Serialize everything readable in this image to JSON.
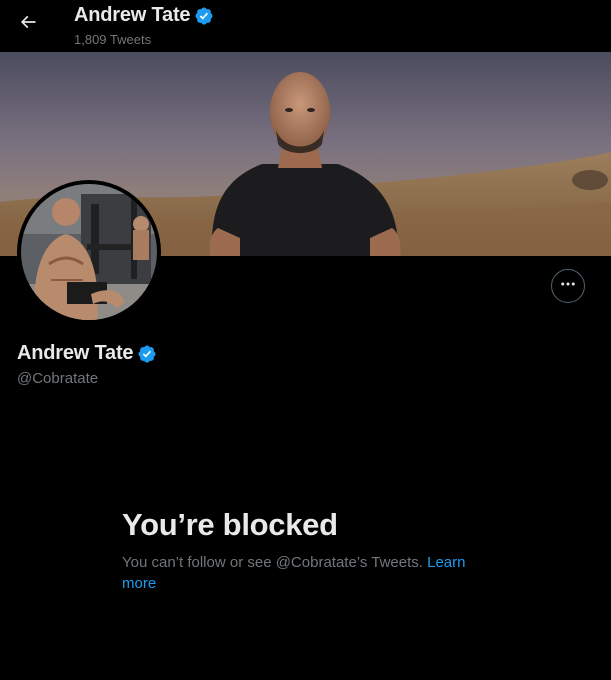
{
  "header": {
    "name": "Andrew Tate",
    "tweet_count": "1,809 Tweets"
  },
  "profile": {
    "name": "Andrew Tate",
    "handle": "@Cobratate"
  },
  "blocked": {
    "title": "You’re blocked",
    "message": "You can’t follow or see @Cobratate’s Tweets. ",
    "link": "Learn more"
  },
  "colors": {
    "background": "#000000",
    "text_primary": "#e7e9ea",
    "text_secondary": "#71767b",
    "accent": "#1d9bf0",
    "verified": "#1d9bf0"
  },
  "icons": {
    "back": "arrow-left-icon",
    "verified": "verified-badge-icon",
    "more": "more-dots-icon"
  }
}
